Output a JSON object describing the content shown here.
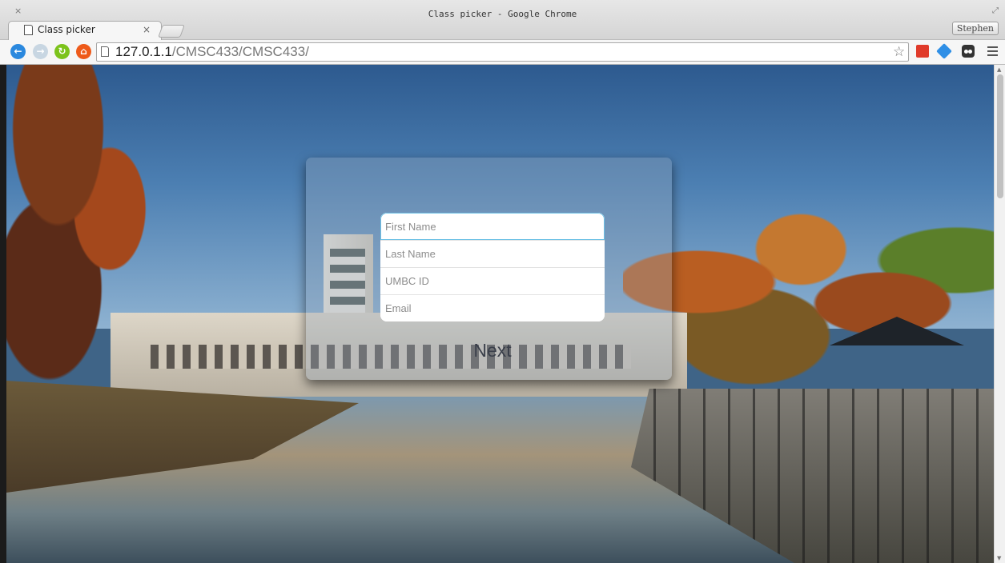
{
  "window": {
    "title": "Class picker - Google Chrome",
    "close_glyph": "×",
    "profile_name": "Stephen"
  },
  "tab": {
    "label": "Class picker",
    "close_glyph": "×"
  },
  "address_bar": {
    "host": "127.0.1.1",
    "path": "/CMSC433/CMSC433/"
  },
  "form": {
    "first_name_placeholder": "First Name",
    "last_name_placeholder": "Last Name",
    "umbc_id_placeholder": "UMBC ID",
    "email_placeholder": "Email",
    "next_label": "Next"
  },
  "icons": {
    "back": "back-arrow-icon",
    "forward": "forward-arrow-icon",
    "reload": "reload-icon",
    "home": "home-icon",
    "bookmark": "star-icon",
    "menu": "hamburger-menu-icon"
  },
  "colors": {
    "back_button": "#2a88de",
    "reload_button": "#7cc31b",
    "home_button": "#ee5a1a",
    "focus_ring": "#6ec2e6"
  }
}
